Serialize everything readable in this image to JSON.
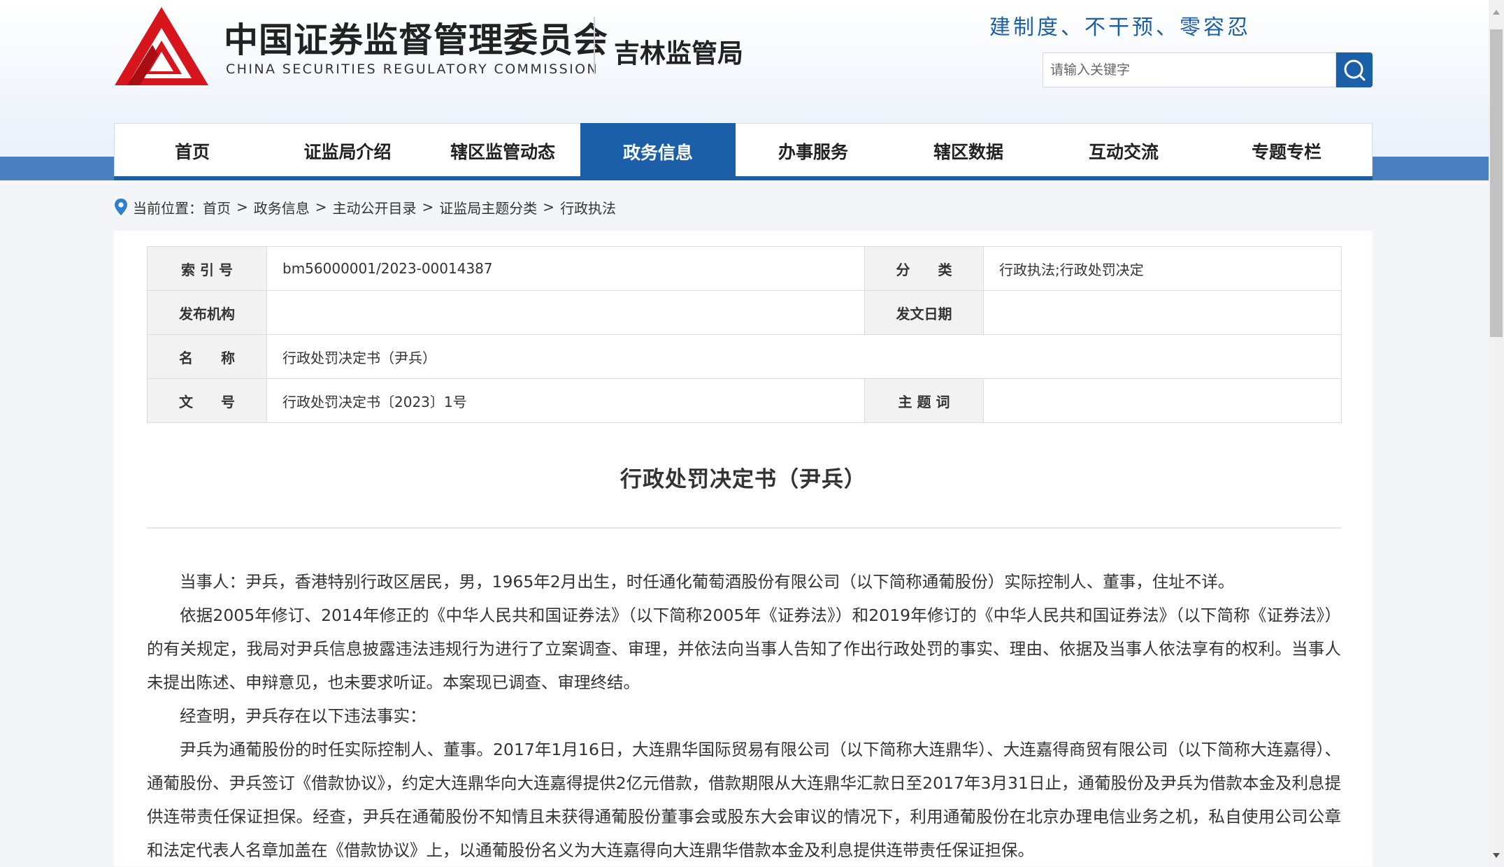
{
  "header": {
    "org_cn": "中国证券监督管理委员会",
    "org_en": "CHINA SECURITIES REGULATORY COMMISSION",
    "bureau": "吉林监管局",
    "slogan": "建制度、不干预、零容忍",
    "search_placeholder": "请输入关键字",
    "brand_color": "#1b5fa8",
    "logo_color": "#d7151c"
  },
  "nav": {
    "items": [
      {
        "label": "首页",
        "active": false
      },
      {
        "label": "证监局介绍",
        "active": false
      },
      {
        "label": "辖区监管动态",
        "active": false
      },
      {
        "label": "政务信息",
        "active": true
      },
      {
        "label": "办事服务",
        "active": false
      },
      {
        "label": "辖区数据",
        "active": false
      },
      {
        "label": "互动交流",
        "active": false
      },
      {
        "label": "专题专栏",
        "active": false
      }
    ]
  },
  "breadcrumb": {
    "prefix": "当前位置：",
    "items": [
      "首页",
      "政务信息",
      "主动公开目录",
      "证监局主题分类",
      "行政执法"
    ],
    "separator": ">"
  },
  "meta": {
    "index_label": "索 引 号",
    "index_value": "bm56000001/2023-00014387",
    "category_label": "分　　类",
    "category_value": "行政执法;行政处罚决定",
    "publisher_label": "发布机构",
    "publisher_value": "",
    "date_label": "发文日期",
    "date_value": "",
    "name_label": "名　　称",
    "name_value": "行政处罚决定书（尹兵）",
    "docno_label": "文　　号",
    "docno_value": "行政处罚决定书〔2023〕1号",
    "keywords_label": "主 题 词",
    "keywords_value": ""
  },
  "document": {
    "title": "行政处罚决定书（尹兵）",
    "paragraphs": [
      "当事人：尹兵，香港特别行政区居民，男，1965年2月出生，时任通化葡萄酒股份有限公司（以下简称通葡股份）实际控制人、董事，住址不详。",
      "依据2005年修订、2014年修正的《中华人民共和国证券法》（以下简称2005年《证券法》）和2019年修订的《中华人民共和国证券法》（以下简称《证券法》）的有关规定，我局对尹兵信息披露违法违规行为进行了立案调查、审理，并依法向当事人告知了作出行政处罚的事实、理由、依据及当事人依法享有的权利。当事人未提出陈述、申辩意见，也未要求听证。本案现已调查、审理终结。",
      "经查明，尹兵存在以下违法事实：",
      "尹兵为通葡股份的时任实际控制人、董事。2017年1月16日，大连鼎华国际贸易有限公司（以下简称大连鼎华）、大连嘉得商贸有限公司（以下简称大连嘉得）、通葡股份、尹兵签订《借款协议》，约定大连鼎华向大连嘉得提供2亿元借款，借款期限从大连鼎华汇款日至2017年3月31日止，通葡股份及尹兵为借款本金及利息提供连带责任保证担保。经查，尹兵在通葡股份不知情且未获得通葡股份董事会或股东大会审议的情况下，利用通葡股份在北京办理电信业务之机，私自使用公司公章和法定代表人名章加盖在《借款协议》上，以通葡股份名义为大连嘉得向大连鼎华借款本金及利息提供连带责任保证担保。"
    ]
  }
}
